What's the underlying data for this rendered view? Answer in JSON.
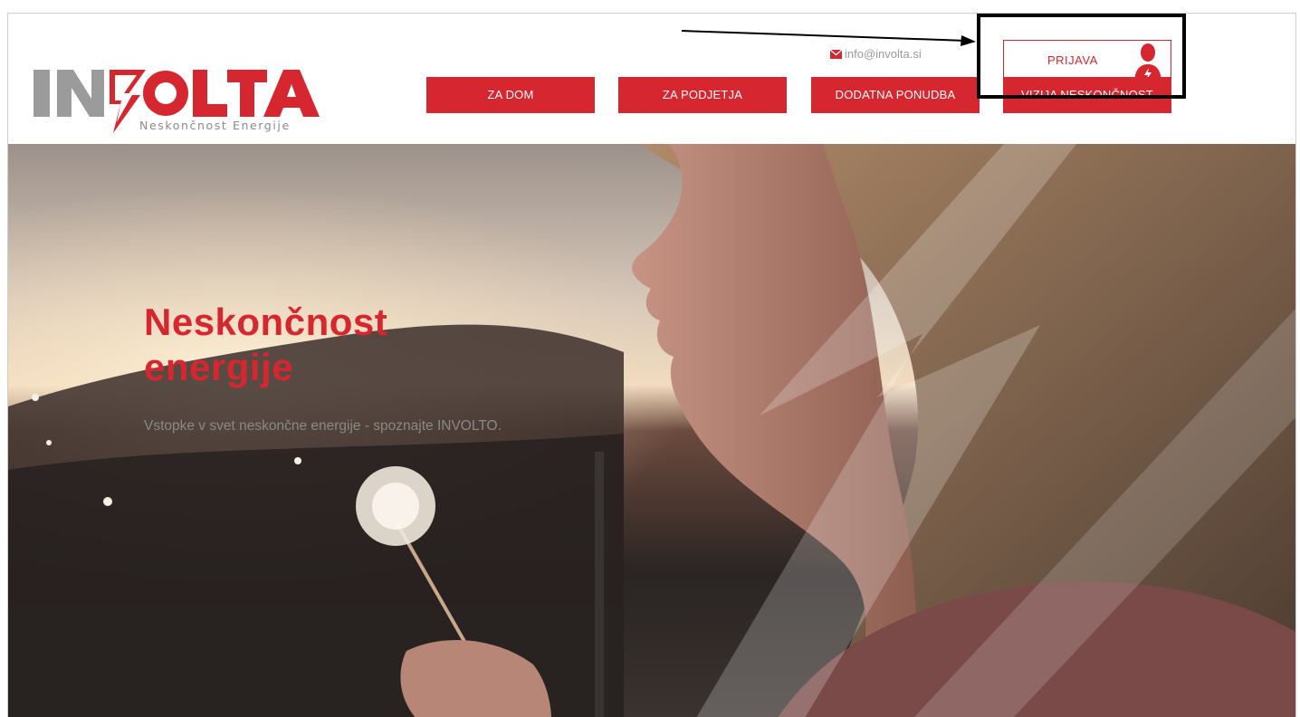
{
  "brand": {
    "logo_text": "INVOLTA",
    "tagline": "Neskončnost Energije",
    "colors": {
      "primary": "#d6262f",
      "grey": "#9b9b9b"
    }
  },
  "header": {
    "email": "info@involta.si",
    "email_icon": "envelope-icon",
    "login_label": "PRIJAVA",
    "login_icon": "user-lightning-icon"
  },
  "nav": {
    "items": [
      {
        "label": "ZA DOM"
      },
      {
        "label": "ZA PODJETJA"
      },
      {
        "label": "DODATNA PONUDBA"
      },
      {
        "label": "VIZIJA NESKONČNOST"
      }
    ]
  },
  "hero": {
    "title": "Neskončnost energije",
    "subtitle": "Vstopke v svet neskončne energije - spoznajte INVOLTO."
  }
}
